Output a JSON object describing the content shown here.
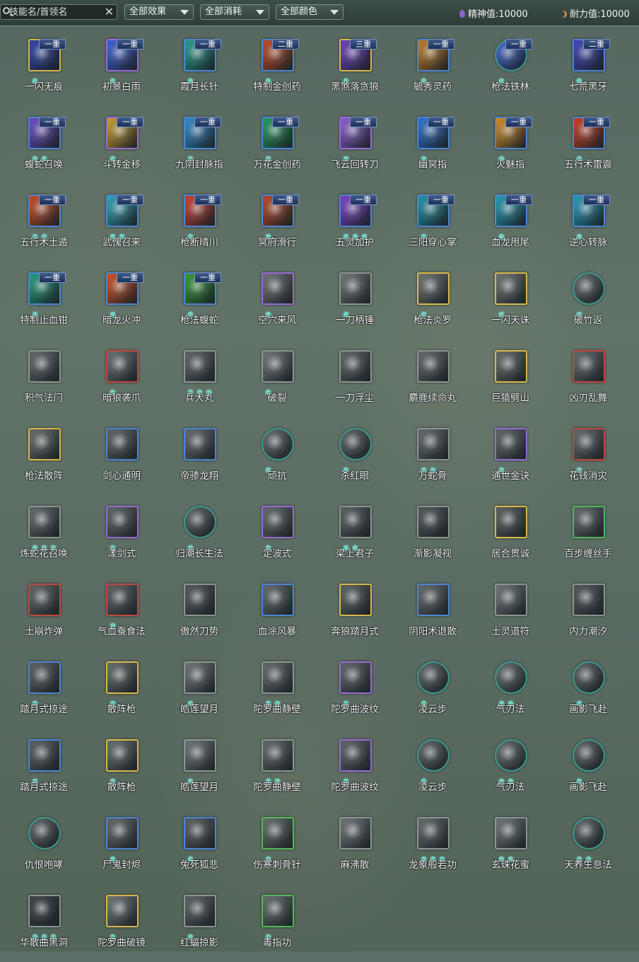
{
  "toolbar": {
    "search_placeholder": "技能名/首领名",
    "clear_symbol": "✕",
    "filter_effect": "全部效果",
    "filter_cost": "全部消耗",
    "filter_color": "全部颜色",
    "spirit_label": "精神值:",
    "spirit_value": "10000",
    "stamina_label": "耐力值:",
    "stamina_value": "10000"
  },
  "colors": {
    "gold": "#d9b84a",
    "purple": "#9a6ad6",
    "blue": "#4d86d6",
    "green": "#54b85a",
    "red": "#c2473f",
    "grey": "#8c9691",
    "teal": "#3a9c8e"
  },
  "skills": [
    {
      "name": "一闪无痕",
      "tier": "一重",
      "dots": 1,
      "color": "gold",
      "art": "#2b3fa8"
    },
    {
      "name": "初景白雨",
      "tier": "一重",
      "dots": 1,
      "color": "purple",
      "art": "#3a5cd8"
    },
    {
      "name": "霞月长针",
      "tier": "一重",
      "dots": 1,
      "color": "blue",
      "art": "#1f9b8a"
    },
    {
      "name": "特制金创药",
      "tier": "二重",
      "dots": 1,
      "color": "blue",
      "art": "#c2441e"
    },
    {
      "name": "黑煞落贪狼",
      "tier": "三重",
      "dots": 1,
      "color": "gold",
      "art": "#6a3ac2"
    },
    {
      "name": "毓秀灵药",
      "tier": "一重",
      "dots": 1,
      "color": "blue",
      "art": "#c27a1e"
    },
    {
      "name": "枪法铁林",
      "tier": "一重",
      "dots": 1,
      "color": "round",
      "art": "#3b5fd0"
    },
    {
      "name": "七荒黑牙",
      "tier": "二重",
      "dots": 1,
      "color": "blue",
      "art": "#3b3fb8"
    },
    {
      "name": "蝮蛇召唤",
      "tier": "一重",
      "dots": 2,
      "color": "blue",
      "art": "#6a48c8"
    },
    {
      "name": "斗转金移",
      "tier": "一重",
      "dots": 1,
      "color": "purple",
      "art": "#c89a2a"
    },
    {
      "name": "九阴封脉指",
      "tier": "一重",
      "dots": 1,
      "color": "blue",
      "art": "#2a88c8"
    },
    {
      "name": "万花金创药",
      "tier": "一重",
      "dots": 1,
      "color": "blue",
      "art": "#1e9a5a"
    },
    {
      "name": "飞云回转刀",
      "tier": "一重",
      "dots": 1,
      "color": "purple",
      "art": "#8a5ad0"
    },
    {
      "name": "幽冥指",
      "tier": "一重",
      "dots": 1,
      "color": "blue",
      "art": "#2a6ed0"
    },
    {
      "name": "火魅指",
      "tier": "一重",
      "dots": 1,
      "color": "blue",
      "art": "#d0881e"
    },
    {
      "name": "五行术雷震",
      "tier": "一重",
      "dots": 1,
      "color": "blue",
      "art": "#c83a1e"
    },
    {
      "name": "五行术土遁",
      "tier": "一重",
      "dots": 2,
      "color": "blue",
      "art": "#c8481e"
    },
    {
      "name": "武傀召来",
      "tier": "一重",
      "dots": 2,
      "color": "blue",
      "art": "#2aa0b8"
    },
    {
      "name": "枪断晴川",
      "tier": "一重",
      "dots": 1,
      "color": "blue",
      "art": "#c83a2a"
    },
    {
      "name": "冥府滑行",
      "tier": "一重",
      "dots": 1,
      "color": "blue",
      "art": "#b8421e"
    },
    {
      "name": "五灵加护",
      "tier": "一重",
      "dots": 3,
      "color": "blue",
      "art": "#7a3ac8"
    },
    {
      "name": "三阳穿心掌",
      "tier": "一重",
      "dots": 1,
      "color": "blue",
      "art": "#1e90a0"
    },
    {
      "name": "血龙甩尾",
      "tier": "一重",
      "dots": 1,
      "color": "blue",
      "art": "#1e98b0"
    },
    {
      "name": "逆心转脉",
      "tier": "一重",
      "dots": 1,
      "color": "blue",
      "art": "#1e9ab8"
    },
    {
      "name": "特制止血钳",
      "tier": "一重",
      "dots": 1,
      "color": "blue",
      "art": "#1e9a7a"
    },
    {
      "name": "暗龙火冲",
      "tier": "一重",
      "dots": 1,
      "color": "blue",
      "art": "#d04a1e"
    },
    {
      "name": "枪法蝮蛇",
      "tier": "一重",
      "dots": 1,
      "color": "blue",
      "art": "#2e9a2e"
    },
    {
      "name": "空穴来风",
      "tier": "",
      "dots": 1,
      "color": "purple",
      "art": "#6a6e70"
    },
    {
      "name": "一刀柄锤",
      "tier": "",
      "dots": 1,
      "color": "grey",
      "art": "#6a6e70"
    },
    {
      "name": "枪法炎罗",
      "tier": "",
      "dots": 1,
      "color": "gold",
      "art": "#6a6e70"
    },
    {
      "name": "一闪天诛",
      "tier": "",
      "dots": 1,
      "color": "gold",
      "art": "#6a6e70"
    },
    {
      "name": "破竹返",
      "tier": "",
      "dots": 1,
      "color": "round",
      "art": "#5a6264"
    },
    {
      "name": "积气法门",
      "tier": "",
      "dots": 0,
      "color": "grey",
      "art": "#5e6466"
    },
    {
      "name": "暗狼袭爪",
      "tier": "",
      "dots": 1,
      "color": "red",
      "art": "#646a6c"
    },
    {
      "name": "兵犬丸",
      "tier": "",
      "dots": 3,
      "color": "grey",
      "art": "#5a6062"
    },
    {
      "name": "破裂",
      "tier": "",
      "dots": 1,
      "color": "grey",
      "art": "#6a7072"
    },
    {
      "name": "一刀浮尘",
      "tier": "",
      "dots": 0,
      "color": "grey",
      "art": "#5a6062"
    },
    {
      "name": "麝鹿续命丸",
      "tier": "",
      "dots": 0,
      "color": "grey",
      "art": "#5e6466"
    },
    {
      "name": "巨猿劈山",
      "tier": "",
      "dots": 0,
      "color": "gold",
      "art": "#626868"
    },
    {
      "name": "凶刃乱舞",
      "tier": "",
      "dots": 0,
      "color": "red",
      "art": "#5e6466"
    },
    {
      "name": "枪法散阵",
      "tier": "",
      "dots": 0,
      "color": "gold",
      "art": "#626868"
    },
    {
      "name": "剑心通明",
      "tier": "",
      "dots": 0,
      "color": "blue",
      "art": "#5a6062"
    },
    {
      "name": "帝骖龙翔",
      "tier": "",
      "dots": 0,
      "color": "blue",
      "art": "#5e6466"
    },
    {
      "name": "顽抗",
      "tier": "",
      "dots": 1,
      "color": "round",
      "art": "#5a6062"
    },
    {
      "name": "杀红眼",
      "tier": "",
      "dots": 1,
      "color": "round",
      "art": "#565c5e"
    },
    {
      "name": "万蛇骨",
      "tier": "",
      "dots": 2,
      "color": "grey",
      "art": "#5e6466"
    },
    {
      "name": "通世金诀",
      "tier": "",
      "dots": 1,
      "color": "purple",
      "art": "#5a6062"
    },
    {
      "name": "花钱消灾",
      "tier": "",
      "dots": 1,
      "color": "red",
      "art": "#5e6466"
    },
    {
      "name": "炼蛇花召唤",
      "tier": "",
      "dots": 3,
      "color": "grey",
      "art": "#5e6466"
    },
    {
      "name": "漾剑式",
      "tier": "",
      "dots": 1,
      "color": "purple",
      "art": "#5a6062"
    },
    {
      "name": "归潮长生法",
      "tier": "",
      "dots": 1,
      "color": "round",
      "art": "#565c5e"
    },
    {
      "name": "定波式",
      "tier": "",
      "dots": 1,
      "color": "purple",
      "art": "#5e6466"
    },
    {
      "name": "梁上君子",
      "tier": "",
      "dots": 2,
      "color": "grey",
      "art": "#565c5e"
    },
    {
      "name": "渐影凝视",
      "tier": "",
      "dots": 0,
      "color": "grey",
      "art": "#4e5456"
    },
    {
      "name": "居合贯诚",
      "tier": "",
      "dots": 0,
      "color": "gold",
      "art": "#565c5e"
    },
    {
      "name": "百步缠丝手",
      "tier": "",
      "dots": 0,
      "color": "green",
      "art": "#5e6466"
    },
    {
      "name": "土崩炸弹",
      "tier": "",
      "dots": 0,
      "color": "red",
      "art": "#5a6062"
    },
    {
      "name": "气血蚕食法",
      "tier": "",
      "dots": 1,
      "color": "red",
      "art": "#565c5e"
    },
    {
      "name": "傲然刀势",
      "tier": "",
      "dots": 0,
      "color": "grey",
      "art": "#4e5456"
    },
    {
      "name": "血涂风暴",
      "tier": "",
      "dots": 0,
      "color": "blue",
      "art": "#5e6466"
    },
    {
      "name": "奔狼踏月式",
      "tier": "",
      "dots": 0,
      "color": "gold",
      "art": "#565c5e"
    },
    {
      "name": "阴阳术退散",
      "tier": "",
      "dots": 0,
      "color": "blue",
      "art": "#5e6466"
    },
    {
      "name": "土灵道符",
      "tier": "",
      "dots": 0,
      "color": "grey",
      "art": "#6a7072"
    },
    {
      "name": "内力潮汐",
      "tier": "",
      "dots": 0,
      "color": "grey",
      "art": "#4e5456"
    },
    {
      "name": "踏月式掠途",
      "tier": "",
      "dots": 1,
      "color": "blue",
      "art": "#565c5e"
    },
    {
      "name": "散阵枪",
      "tier": "",
      "dots": 1,
      "color": "gold",
      "art": "#626868"
    },
    {
      "name": "皓莲望月",
      "tier": "",
      "dots": 1,
      "color": "grey",
      "art": "#6a7072"
    },
    {
      "name": "陀罗曲静壁",
      "tier": "",
      "dots": 2,
      "color": "grey",
      "art": "#5e6466"
    },
    {
      "name": "陀罗曲波纹",
      "tier": "",
      "dots": 1,
      "color": "purple",
      "art": "#5a6062"
    },
    {
      "name": "凌云步",
      "tier": "",
      "dots": 1,
      "color": "round",
      "art": "#565c5e"
    },
    {
      "name": "气刃法",
      "tier": "",
      "dots": 2,
      "color": "round",
      "art": "#5e6466"
    },
    {
      "name": "画影飞赴",
      "tier": "",
      "dots": 1,
      "color": "round",
      "art": "#565c5e"
    },
    {
      "name": "踏月式掠途",
      "tier": "",
      "dots": 1,
      "color": "blue",
      "art": "#565c5e"
    },
    {
      "name": "散阵枪",
      "tier": "",
      "dots": 1,
      "color": "gold",
      "art": "#626868"
    },
    {
      "name": "皓莲望月",
      "tier": "",
      "dots": 1,
      "color": "grey",
      "art": "#6a7072"
    },
    {
      "name": "陀罗曲静壁",
      "tier": "",
      "dots": 2,
      "color": "grey",
      "art": "#5e6466"
    },
    {
      "name": "陀罗曲波纹",
      "tier": "",
      "dots": 1,
      "color": "purple",
      "art": "#5a6062"
    },
    {
      "name": "凌云步",
      "tier": "",
      "dots": 1,
      "color": "round",
      "art": "#565c5e"
    },
    {
      "name": "气刃法",
      "tier": "",
      "dots": 2,
      "color": "round",
      "art": "#5e6466"
    },
    {
      "name": "画影飞赴",
      "tier": "",
      "dots": 1,
      "color": "round",
      "art": "#565c5e"
    },
    {
      "name": "仇恨咆哮",
      "tier": "",
      "dots": 0,
      "color": "round",
      "art": "#565c5e"
    },
    {
      "name": "尸鬼封烬",
      "tier": "",
      "dots": 1,
      "color": "blue",
      "art": "#5e6466"
    },
    {
      "name": "兔死狐悲",
      "tier": "",
      "dots": 1,
      "color": "blue",
      "art": "#565c5e"
    },
    {
      "name": "伤寒刺骨针",
      "tier": "",
      "dots": 1,
      "color": "green",
      "art": "#626868"
    },
    {
      "name": "麻沸散",
      "tier": "",
      "dots": 0,
      "color": "grey",
      "art": "#6a7072"
    },
    {
      "name": "龙象般若功",
      "tier": "",
      "dots": 3,
      "color": "grey",
      "art": "#5e6466"
    },
    {
      "name": "玄珠花蜜",
      "tier": "",
      "dots": 2,
      "color": "grey",
      "art": "#6a7072"
    },
    {
      "name": "天养生息法",
      "tier": "",
      "dots": 2,
      "color": "round",
      "art": "#565c5e"
    },
    {
      "name": "华散曲黑洞",
      "tier": "",
      "dots": 3,
      "color": "grey",
      "art": "#3a3e40"
    },
    {
      "name": "陀罗曲破镜",
      "tier": "",
      "dots": 1,
      "color": "gold",
      "art": "#6a7072"
    },
    {
      "name": "红蝠掠影",
      "tier": "",
      "dots": 1,
      "color": "grey",
      "art": "#565c5e"
    },
    {
      "name": "毒指功",
      "tier": "",
      "dots": 1,
      "color": "green",
      "art": "#626868"
    }
  ]
}
